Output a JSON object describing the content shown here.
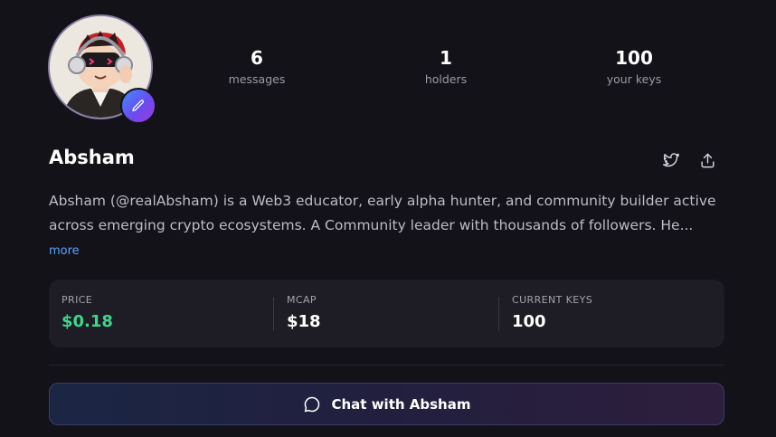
{
  "profile": {
    "name": "Absham",
    "bio_line1": "Absham (@realAbsham) is a Web3 educator, early alpha hunter, and community builder active",
    "bio_line2": "across emerging crypto ecosystems. A Community leader with thousands of followers. He...",
    "more_label": "more"
  },
  "stats": [
    {
      "value": "6",
      "label": "messages"
    },
    {
      "value": "1",
      "label": "holders"
    },
    {
      "value": "100",
      "label": "your keys"
    }
  ],
  "market": {
    "price_label": "PRICE",
    "price_value": "$0.18",
    "mcap_label": "MCAP",
    "mcap_value": "$18",
    "keys_label": "CURRENT KEYS",
    "keys_value": "100"
  },
  "actions": {
    "chat_label": "Chat with Absham"
  },
  "colors": {
    "background": "#131219",
    "price_green": "#3fd68a",
    "link_blue": "#5aa3ff"
  },
  "icons": [
    "avatar",
    "pencil-icon",
    "twitter-icon",
    "share-icon",
    "chat-bubble-icon"
  ]
}
